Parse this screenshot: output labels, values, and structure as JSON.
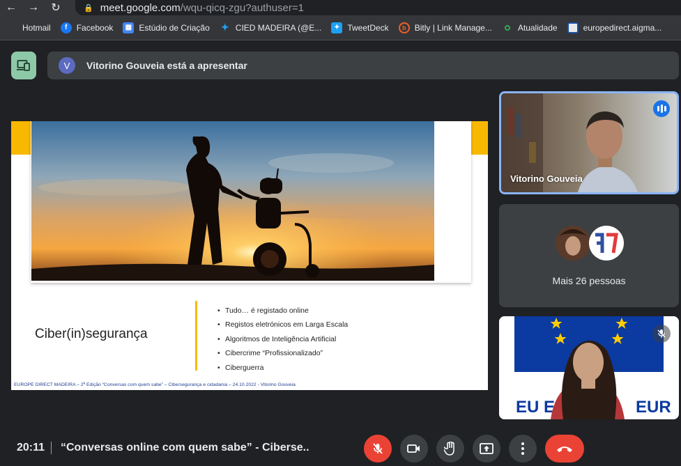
{
  "browser": {
    "url_host": "meet.google.com",
    "url_path": "/wqu-qicq-zgu?authuser=1",
    "bookmarks": [
      {
        "label": "Hotmail",
        "icon": "microsoft-icon"
      },
      {
        "label": "Facebook",
        "icon": "facebook-icon"
      },
      {
        "label": "Estúdio de Criação",
        "icon": "calendar-icon"
      },
      {
        "label": "CIED MADEIRA (@E...",
        "icon": "twitter-icon"
      },
      {
        "label": "TweetDeck",
        "icon": "tweetdeck-icon"
      },
      {
        "label": "Bitly | Link Manage...",
        "icon": "bitly-icon"
      },
      {
        "label": "Atualidade",
        "icon": "dot-icon"
      },
      {
        "label": "europedirect.aigma...",
        "icon": "site-icon"
      }
    ]
  },
  "presenting": {
    "avatar_letter": "V",
    "text": "Vitorino Gouveia está a apresentar"
  },
  "slide": {
    "title": "Ciber(in)segurança",
    "bullets": [
      "Tudo… é registado online",
      "Registos eletrónicos em Larga Escala",
      "Algoritmos de Inteligência Artificial",
      "Cibercrime “Profissionalizado”",
      "Ciberguerra"
    ],
    "footer": "EUROPE DIRECT MADEIRA –  2ª Edição “Conversas com quem sabe” – Cibersegurança e cidadania – 24.10.2022 - Vitorino Gouveia"
  },
  "tiles": {
    "speaker_name": "Vitorino Gouveia",
    "others_label": "Mais 26 pessoas"
  },
  "bottom": {
    "time": "20:11",
    "meeting_title": "“Conversas online com quem sabe” - Ciberse..."
  },
  "colors": {
    "accent_yellow": "#f9b800",
    "present_green": "#8ec9a7",
    "hangup_red": "#ea4335",
    "speaking_blue": "#1a73e8"
  }
}
